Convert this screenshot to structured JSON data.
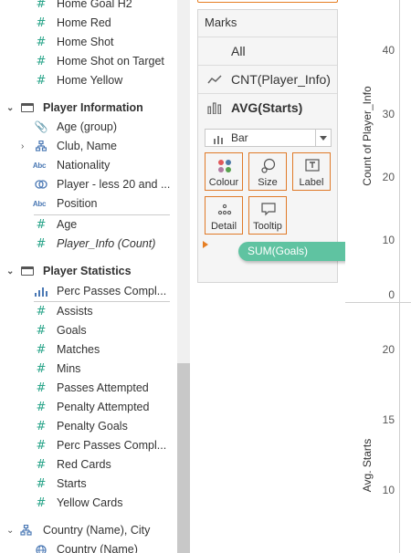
{
  "data_pane": {
    "items_top": [
      {
        "label": "Home Goal H2",
        "icon": "measure-hash-icon"
      },
      {
        "label": "Home Red",
        "icon": "measure-hash-icon"
      },
      {
        "label": "Home Shot",
        "icon": "measure-hash-icon"
      },
      {
        "label": "Home Shot on Target",
        "icon": "measure-hash-icon"
      },
      {
        "label": "Home Yellow",
        "icon": "measure-hash-icon"
      }
    ],
    "folder_player_info": "Player Information",
    "player_info_items": [
      {
        "label": "Age (group)",
        "icon": "paperclip-icon"
      },
      {
        "label": "Club, Name",
        "icon": "hierarchy-icon"
      },
      {
        "label": "Nationality",
        "icon": "abc-icon"
      },
      {
        "label": "Player - less 20 and ...",
        "icon": "set-icon"
      },
      {
        "label": "Position",
        "icon": "abc-icon"
      },
      {
        "label": "Age",
        "icon": "measure-hash-icon"
      },
      {
        "label": "Player_Info (Count)",
        "icon": "measure-hash-icon"
      }
    ],
    "folder_player_stats": "Player Statistics",
    "player_stats_items": [
      {
        "label": "Perc Passes Compl...",
        "icon": "bin-bars-icon"
      },
      {
        "label": "Assists",
        "icon": "measure-hash-icon"
      },
      {
        "label": "Goals",
        "icon": "measure-hash-icon"
      },
      {
        "label": "Matches",
        "icon": "measure-hash-icon"
      },
      {
        "label": "Mins",
        "icon": "measure-hash-icon"
      },
      {
        "label": "Passes Attempted",
        "icon": "measure-hash-icon"
      },
      {
        "label": "Penalty Attempted",
        "icon": "measure-hash-icon"
      },
      {
        "label": "Penalty Goals",
        "icon": "measure-hash-icon"
      },
      {
        "label": "Perc Passes Compl...",
        "icon": "measure-hash-icon"
      },
      {
        "label": "Red Cards",
        "icon": "measure-hash-icon"
      },
      {
        "label": "Starts",
        "icon": "measure-hash-icon"
      },
      {
        "label": "Yellow Cards",
        "icon": "measure-hash-icon"
      }
    ],
    "hierarchy_country": "Country (Name), City",
    "country_child": "Country (Name)"
  },
  "marks": {
    "title": "Marks",
    "rows": [
      {
        "label": "All",
        "icon": "none"
      },
      {
        "label": "CNT(Player_Info)",
        "icon": "line-mark-icon"
      },
      {
        "label": "AVG(Starts)",
        "icon": "bar-mark-icon"
      }
    ],
    "mark_type": "Bar",
    "buttons": {
      "colour": "Colour",
      "size": "Size",
      "label": "Label",
      "detail": "Detail",
      "tooltip": "Tooltip"
    },
    "drag_pill": "SUM(Goals)"
  },
  "axes": {
    "top": {
      "title": "Count of Player_Info",
      "ticks": [
        "40",
        "30",
        "20",
        "10",
        "0"
      ]
    },
    "bottom": {
      "title": "Avg. Starts",
      "ticks": [
        "20",
        "15",
        "10"
      ]
    }
  },
  "colors": {
    "measure_green": "#2aa58a",
    "dimension_blue": "#4a78b4",
    "marks_border_orange": "#e07a28",
    "pill_green": "#5fc3a1"
  }
}
